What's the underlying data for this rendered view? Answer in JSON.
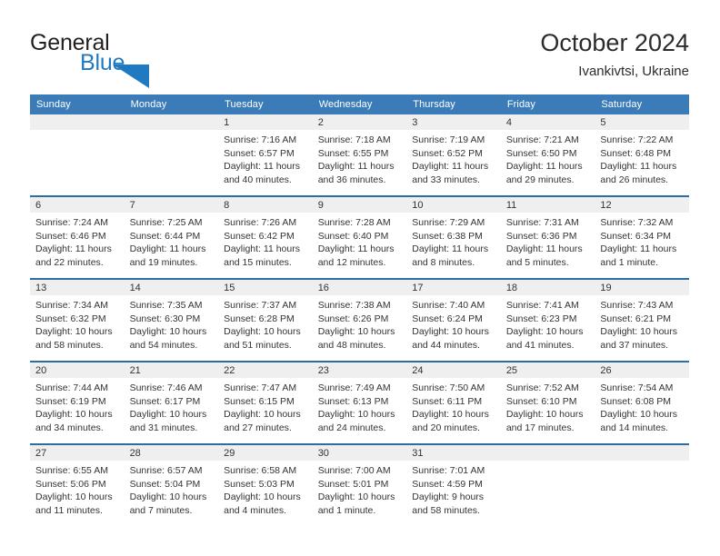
{
  "brand": {
    "name_top": "General",
    "name_bottom": "Blue",
    "logo_icon": "triangle-icon",
    "color_dark": "#231f20",
    "color_blue": "#1f7ac1"
  },
  "header": {
    "title": "October 2024",
    "subtitle": "Ivankivtsi, Ukraine"
  },
  "theme": {
    "header_blue": "#3b7cb8",
    "row_rule_blue": "#2e6da4",
    "daynum_band": "#efefef",
    "text": "#333333"
  },
  "calendar": {
    "weekday_headers": [
      "Sunday",
      "Monday",
      "Tuesday",
      "Wednesday",
      "Thursday",
      "Friday",
      "Saturday"
    ],
    "weeks": [
      [
        {
          "day": "",
          "lines": []
        },
        {
          "day": "",
          "lines": []
        },
        {
          "day": "1",
          "lines": [
            "Sunrise: 7:16 AM",
            "Sunset: 6:57 PM",
            "Daylight: 11 hours",
            "and 40 minutes."
          ]
        },
        {
          "day": "2",
          "lines": [
            "Sunrise: 7:18 AM",
            "Sunset: 6:55 PM",
            "Daylight: 11 hours",
            "and 36 minutes."
          ]
        },
        {
          "day": "3",
          "lines": [
            "Sunrise: 7:19 AM",
            "Sunset: 6:52 PM",
            "Daylight: 11 hours",
            "and 33 minutes."
          ]
        },
        {
          "day": "4",
          "lines": [
            "Sunrise: 7:21 AM",
            "Sunset: 6:50 PM",
            "Daylight: 11 hours",
            "and 29 minutes."
          ]
        },
        {
          "day": "5",
          "lines": [
            "Sunrise: 7:22 AM",
            "Sunset: 6:48 PM",
            "Daylight: 11 hours",
            "and 26 minutes."
          ]
        }
      ],
      [
        {
          "day": "6",
          "lines": [
            "Sunrise: 7:24 AM",
            "Sunset: 6:46 PM",
            "Daylight: 11 hours",
            "and 22 minutes."
          ]
        },
        {
          "day": "7",
          "lines": [
            "Sunrise: 7:25 AM",
            "Sunset: 6:44 PM",
            "Daylight: 11 hours",
            "and 19 minutes."
          ]
        },
        {
          "day": "8",
          "lines": [
            "Sunrise: 7:26 AM",
            "Sunset: 6:42 PM",
            "Daylight: 11 hours",
            "and 15 minutes."
          ]
        },
        {
          "day": "9",
          "lines": [
            "Sunrise: 7:28 AM",
            "Sunset: 6:40 PM",
            "Daylight: 11 hours",
            "and 12 minutes."
          ]
        },
        {
          "day": "10",
          "lines": [
            "Sunrise: 7:29 AM",
            "Sunset: 6:38 PM",
            "Daylight: 11 hours",
            "and 8 minutes."
          ]
        },
        {
          "day": "11",
          "lines": [
            "Sunrise: 7:31 AM",
            "Sunset: 6:36 PM",
            "Daylight: 11 hours",
            "and 5 minutes."
          ]
        },
        {
          "day": "12",
          "lines": [
            "Sunrise: 7:32 AM",
            "Sunset: 6:34 PM",
            "Daylight: 11 hours",
            "and 1 minute."
          ]
        }
      ],
      [
        {
          "day": "13",
          "lines": [
            "Sunrise: 7:34 AM",
            "Sunset: 6:32 PM",
            "Daylight: 10 hours",
            "and 58 minutes."
          ]
        },
        {
          "day": "14",
          "lines": [
            "Sunrise: 7:35 AM",
            "Sunset: 6:30 PM",
            "Daylight: 10 hours",
            "and 54 minutes."
          ]
        },
        {
          "day": "15",
          "lines": [
            "Sunrise: 7:37 AM",
            "Sunset: 6:28 PM",
            "Daylight: 10 hours",
            "and 51 minutes."
          ]
        },
        {
          "day": "16",
          "lines": [
            "Sunrise: 7:38 AM",
            "Sunset: 6:26 PM",
            "Daylight: 10 hours",
            "and 48 minutes."
          ]
        },
        {
          "day": "17",
          "lines": [
            "Sunrise: 7:40 AM",
            "Sunset: 6:24 PM",
            "Daylight: 10 hours",
            "and 44 minutes."
          ]
        },
        {
          "day": "18",
          "lines": [
            "Sunrise: 7:41 AM",
            "Sunset: 6:23 PM",
            "Daylight: 10 hours",
            "and 41 minutes."
          ]
        },
        {
          "day": "19",
          "lines": [
            "Sunrise: 7:43 AM",
            "Sunset: 6:21 PM",
            "Daylight: 10 hours",
            "and 37 minutes."
          ]
        }
      ],
      [
        {
          "day": "20",
          "lines": [
            "Sunrise: 7:44 AM",
            "Sunset: 6:19 PM",
            "Daylight: 10 hours",
            "and 34 minutes."
          ]
        },
        {
          "day": "21",
          "lines": [
            "Sunrise: 7:46 AM",
            "Sunset: 6:17 PM",
            "Daylight: 10 hours",
            "and 31 minutes."
          ]
        },
        {
          "day": "22",
          "lines": [
            "Sunrise: 7:47 AM",
            "Sunset: 6:15 PM",
            "Daylight: 10 hours",
            "and 27 minutes."
          ]
        },
        {
          "day": "23",
          "lines": [
            "Sunrise: 7:49 AM",
            "Sunset: 6:13 PM",
            "Daylight: 10 hours",
            "and 24 minutes."
          ]
        },
        {
          "day": "24",
          "lines": [
            "Sunrise: 7:50 AM",
            "Sunset: 6:11 PM",
            "Daylight: 10 hours",
            "and 20 minutes."
          ]
        },
        {
          "day": "25",
          "lines": [
            "Sunrise: 7:52 AM",
            "Sunset: 6:10 PM",
            "Daylight: 10 hours",
            "and 17 minutes."
          ]
        },
        {
          "day": "26",
          "lines": [
            "Sunrise: 7:54 AM",
            "Sunset: 6:08 PM",
            "Daylight: 10 hours",
            "and 14 minutes."
          ]
        }
      ],
      [
        {
          "day": "27",
          "lines": [
            "Sunrise: 6:55 AM",
            "Sunset: 5:06 PM",
            "Daylight: 10 hours",
            "and 11 minutes."
          ]
        },
        {
          "day": "28",
          "lines": [
            "Sunrise: 6:57 AM",
            "Sunset: 5:04 PM",
            "Daylight: 10 hours",
            "and 7 minutes."
          ]
        },
        {
          "day": "29",
          "lines": [
            "Sunrise: 6:58 AM",
            "Sunset: 5:03 PM",
            "Daylight: 10 hours",
            "and 4 minutes."
          ]
        },
        {
          "day": "30",
          "lines": [
            "Sunrise: 7:00 AM",
            "Sunset: 5:01 PM",
            "Daylight: 10 hours",
            "and 1 minute."
          ]
        },
        {
          "day": "31",
          "lines": [
            "Sunrise: 7:01 AM",
            "Sunset: 4:59 PM",
            "Daylight: 9 hours",
            "and 58 minutes."
          ]
        },
        {
          "day": "",
          "lines": []
        },
        {
          "day": "",
          "lines": []
        }
      ]
    ]
  }
}
